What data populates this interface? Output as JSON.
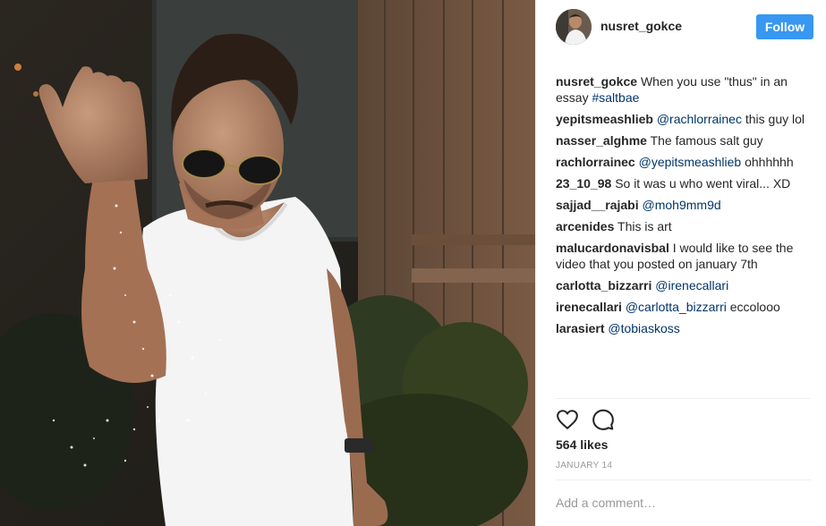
{
  "post": {
    "username": "nusret_gokce",
    "follow_label": "Follow",
    "image_icon": "photo-of-man-sprinkling-salt"
  },
  "comments": [
    {
      "user": "nusret_gokce",
      "text": "When you use \"thus\" in an essay",
      "mention": "#saltbae",
      "after": ""
    },
    {
      "user": "yepitsmeashlieb",
      "text": "",
      "mention": "@rachlorrainec",
      "after": " this guy lol"
    },
    {
      "user": "nasser_alghme",
      "text": "The famous salt guy",
      "mention": "",
      "after": ""
    },
    {
      "user": "rachlorrainec",
      "text": "",
      "mention": "@yepitsmeashlieb",
      "after": " ohhhhhh"
    },
    {
      "user": "23_10_98",
      "text": "So it was u who went viral... XD",
      "mention": "",
      "after": ""
    },
    {
      "user": "sajjad__rajabi",
      "text": "",
      "mention": "@moh9mm9d",
      "after": ""
    },
    {
      "user": "arcenides",
      "text": "This is art",
      "mention": "",
      "after": ""
    },
    {
      "user": "malucardonavisbal",
      "text": "I would like to see the video that you posted on january 7th",
      "mention": "",
      "after": ""
    },
    {
      "user": "carlotta_bizzarri",
      "text": "",
      "mention": "@irenecallari",
      "after": ""
    },
    {
      "user": "irenecallari",
      "text": "",
      "mention": "@carlotta_bizzarri",
      "after": " eccolooo"
    },
    {
      "user": "larasiert",
      "text": "",
      "mention": "@tobiaskoss",
      "after": ""
    }
  ],
  "actions": {
    "like_icon": "heart-outline-icon",
    "comment_icon": "speech-bubble-icon",
    "likes": "564 likes",
    "date": "JANUARY 14"
  },
  "add_comment": {
    "placeholder": "Add a comment…"
  },
  "colors": {
    "follow_bg": "#3897f0",
    "mention": "#003569",
    "muted": "#999999"
  }
}
